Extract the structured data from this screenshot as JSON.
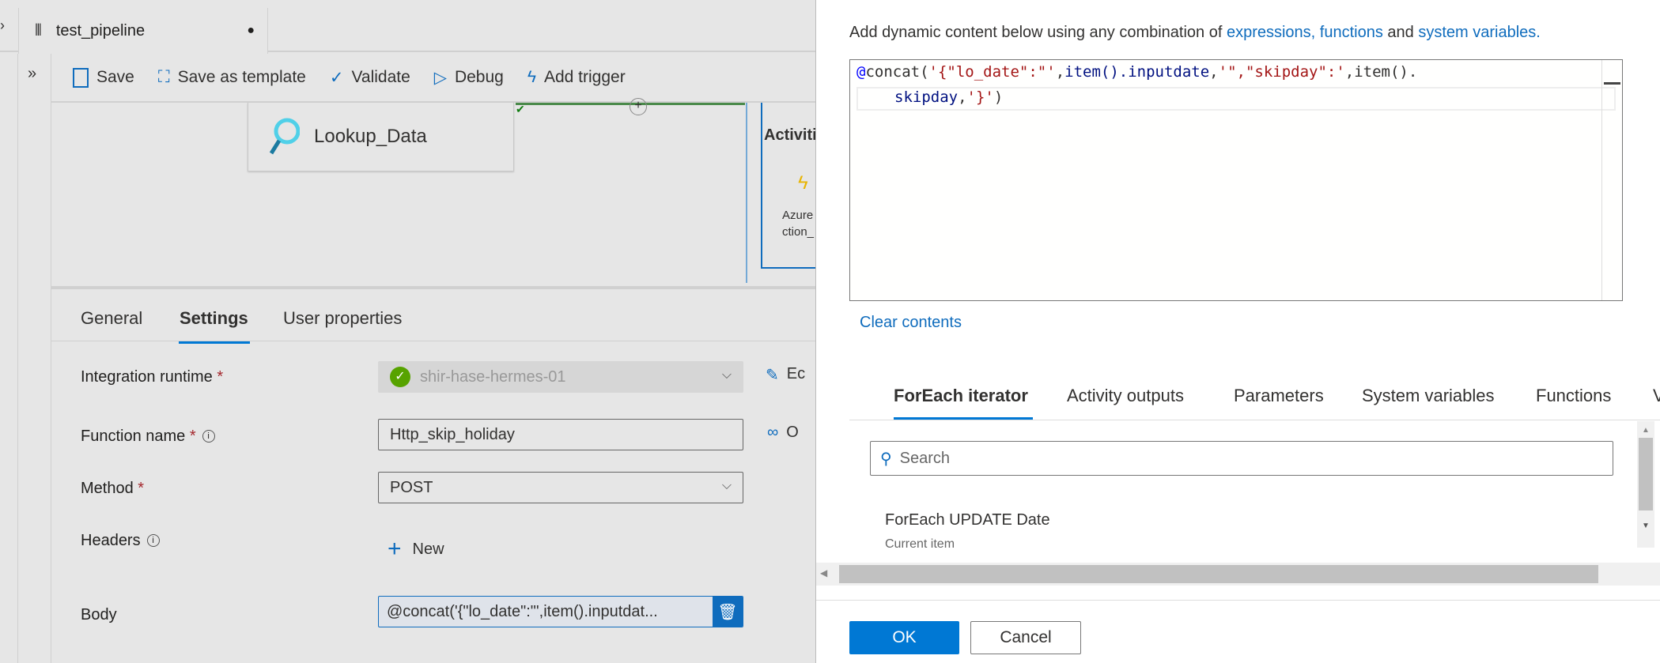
{
  "tab": {
    "title": "test_pipeline",
    "unsaved_indicator": "●"
  },
  "toolbar": {
    "save": "Save",
    "save_as_template": "Save as template",
    "validate": "Validate",
    "debug": "Debug",
    "add_trigger": "Add trigger"
  },
  "canvas": {
    "lookup_activity": "Lookup_Data",
    "foreach_activities_label": "Activiti",
    "azure_function_line1": "Azure",
    "azure_function_line2": "ction_"
  },
  "properties": {
    "tabs": [
      "General",
      "Settings",
      "User properties"
    ],
    "active_tab": "Settings",
    "integration_runtime": {
      "label": "Integration runtime",
      "value": "shir-hase-hermes-01",
      "edit": "Ec"
    },
    "function_name": {
      "label": "Function name",
      "value": "Http_skip_holiday",
      "open": "O"
    },
    "method": {
      "label": "Method",
      "value": "POST"
    },
    "headers": {
      "label": "Headers",
      "new": "New"
    },
    "body": {
      "label": "Body",
      "value": "@concat('{\"lo_date\":\"',item().inputdat..."
    }
  },
  "dialog": {
    "intro_prefix": "Add dynamic content below using any combination of ",
    "intro_link1": "expressions, functions",
    "intro_and": " and ",
    "intro_link2": "system variables.",
    "expression_parts": {
      "at": "@",
      "fn": "concat(",
      "s1": "'{\"lo_date\":\"'",
      "c1": ",",
      "k1": "item().inputdate",
      "c2": ",",
      "s2": "'\",\"skipday\":'",
      "c3": ",",
      "k2": "item().",
      "k3": "skipday",
      "c4": ",",
      "s3": "'}'",
      "close": ")"
    },
    "clear_contents": "Clear contents",
    "tabs": [
      "ForEach iterator",
      "Activity outputs",
      "Parameters",
      "System variables",
      "Functions",
      "V"
    ],
    "active_tab": "ForEach iterator",
    "search_placeholder": "Search",
    "list_item_title": "ForEach UPDATE Date",
    "list_item_sub": "Current item",
    "ok": "OK",
    "cancel": "Cancel"
  },
  "colors": {
    "accent": "#0078d4",
    "success": "#57a300",
    "required": "#a4262c"
  }
}
